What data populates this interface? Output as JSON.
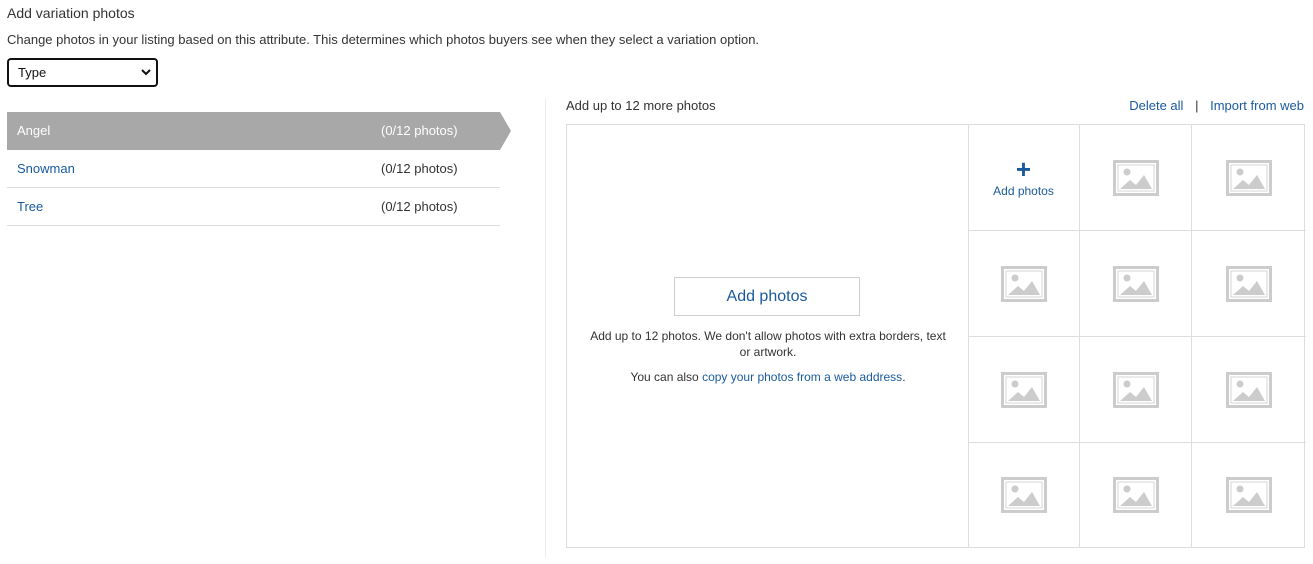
{
  "header": {
    "title": "Add variation photos",
    "description": "Change photos in your listing based on this attribute. This determines which photos buyers see when they select a variation option."
  },
  "attribute_select": {
    "value": "Type"
  },
  "variations": [
    {
      "name": "Angel",
      "count": "(0/12 photos)",
      "selected": true
    },
    {
      "name": "Snowman",
      "count": "(0/12 photos)",
      "selected": false
    },
    {
      "name": "Tree",
      "count": "(0/12 photos)",
      "selected": false
    }
  ],
  "photos_panel": {
    "add_more_label": "Add up to 12 more photos",
    "delete_all": "Delete all",
    "separator": "|",
    "import_from_web": "Import from web",
    "add_button": "Add photos",
    "note": "Add up to 12 photos. We don't allow photos with extra borders, text or artwork.",
    "copy_prefix": "You can also ",
    "copy_link": "copy your photos from a web address",
    "copy_suffix": ".",
    "add_cell_label": "Add photos",
    "add_cell_plus": "+"
  },
  "colors": {
    "link": "#1a5a9c",
    "selected_row": "#a8a8a8",
    "placeholder": "#cccccc"
  }
}
